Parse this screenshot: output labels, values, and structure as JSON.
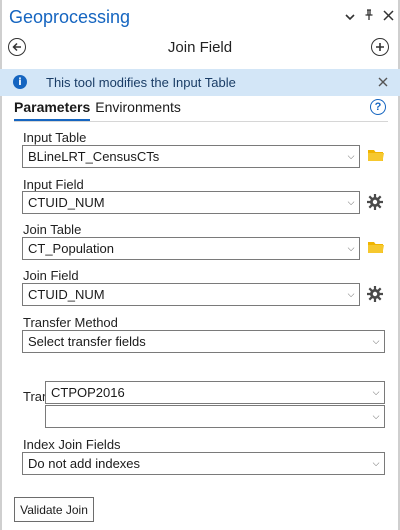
{
  "pane": {
    "title": "Geoprocessing",
    "controls": {
      "menu": "⌄",
      "pin": "⊥",
      "close": "✕"
    }
  },
  "tool": {
    "name": "Join Field"
  },
  "info": {
    "message": "This tool modifies the Input Table"
  },
  "tabs": [
    {
      "label": "Parameters",
      "active": true
    },
    {
      "label": "Environments",
      "active": false
    }
  ],
  "params": {
    "input_table": {
      "label": "Input Table",
      "value": "BLineLRT_CensusCTs"
    },
    "input_field": {
      "label": "Input Field",
      "value": "CTUID_NUM"
    },
    "join_table": {
      "label": "Join Table",
      "value": "CT_Population"
    },
    "join_field": {
      "label": "Join Field",
      "value": "CTUID_NUM"
    },
    "transfer_method": {
      "label": "Transfer Method",
      "value": "Select transfer fields"
    },
    "transfer_fields": {
      "label": "Transfer Fields",
      "items": [
        "CTPOP2016",
        ""
      ]
    },
    "index_join_fields": {
      "label": "Index Join Fields",
      "value": "Do not add indexes"
    }
  },
  "buttons": {
    "validate": "Validate Join"
  },
  "colors": {
    "accent": "#1565c0",
    "info_bg": "#d3e6f7",
    "folder": "#f0b400"
  }
}
